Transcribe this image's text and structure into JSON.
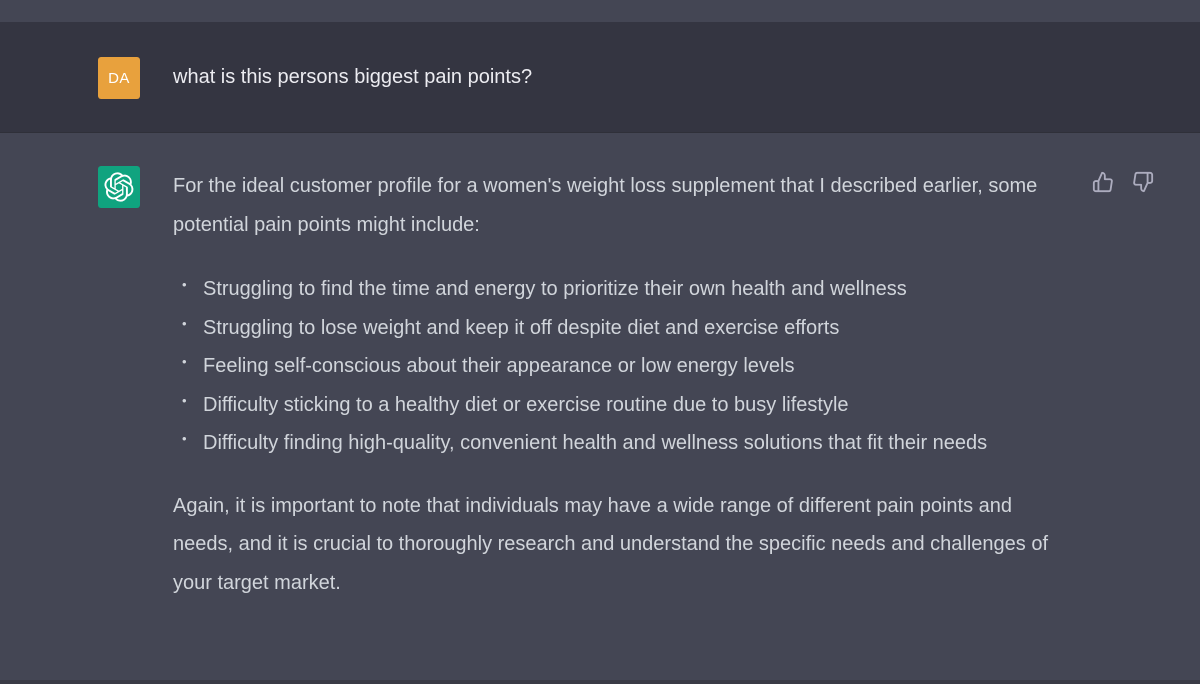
{
  "user_message": {
    "avatar_initials": "DA",
    "avatar_color": "#e8a13d",
    "text": "what is this persons biggest pain points?"
  },
  "assistant_message": {
    "avatar_icon": "openai-logo-icon",
    "avatar_color": "#10a37f",
    "intro": "For the ideal customer profile for a women's weight loss supplement that I described earlier, some potential pain points might include:",
    "bullets": [
      "Struggling to find the time and energy to prioritize their own health and wellness",
      "Struggling to lose weight and keep it off despite diet and exercise efforts",
      "Feeling self-conscious about their appearance or low energy levels",
      "Difficulty sticking to a healthy diet or exercise routine due to busy lifestyle",
      "Difficulty finding high-quality, convenient health and wellness solutions that fit their needs"
    ],
    "closing": "Again, it is important to note that individuals may have a wide range of different pain points and needs, and it is crucial to thoroughly research and understand the specific needs and challenges of your target market.",
    "feedback": {
      "like_icon": "thumbs-up-icon",
      "dislike_icon": "thumbs-down-icon"
    }
  },
  "colors": {
    "user_row_bg": "#343541",
    "assistant_row_bg": "#444654",
    "text": "#d1d5db"
  }
}
